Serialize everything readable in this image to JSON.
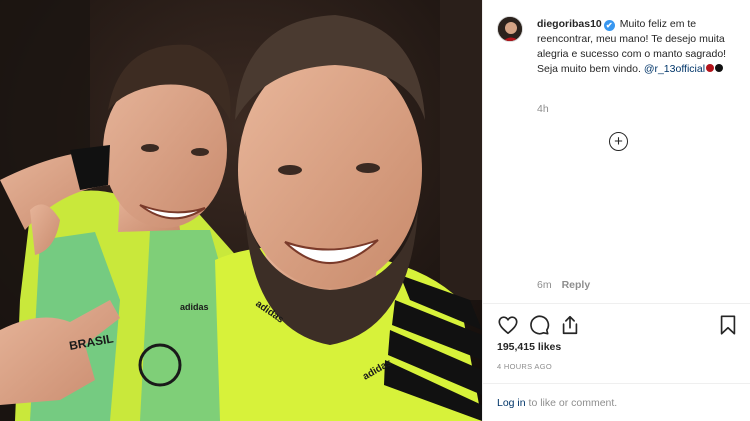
{
  "post": {
    "username": "diegoribas10",
    "caption": "Muito feliz em te reencontrar, meu mano! Te desejo muita alegria e sucesso com o manto sagrado! Seja muito bem vindo.",
    "mention": "@r_13official",
    "caption_time": "4h",
    "verified_badge": "✔",
    "load_more_icon": "+"
  },
  "comment": {
    "time": "6m",
    "reply_label": "Reply"
  },
  "actions": {
    "likes": "195,415 likes",
    "posted": "4 HOURS AGO",
    "icons": [
      "heart-icon",
      "comment-icon",
      "share-icon",
      "bookmark-icon"
    ]
  },
  "login": {
    "link": "Log in",
    "suffix": " to like or comment."
  },
  "colors": {
    "jersey_yellow": "#d7f23a",
    "jersey_black": "#111111",
    "flamengo_red": "#b3141b",
    "link_blue": "#003569",
    "verified_blue": "#3897f0"
  }
}
